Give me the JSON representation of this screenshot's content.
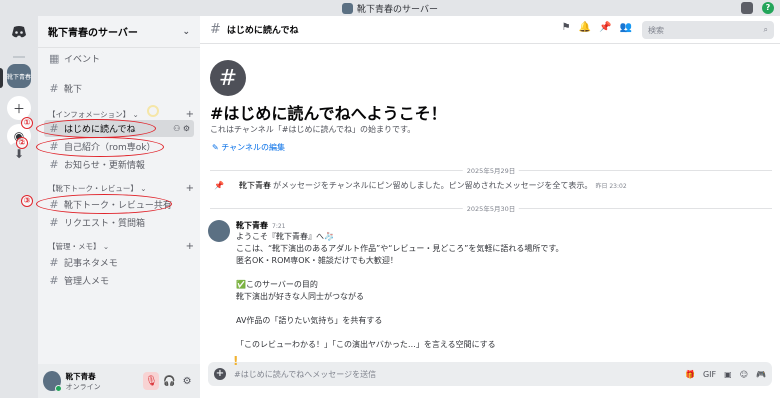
{
  "window": {
    "title": "靴下青春のサーバー"
  },
  "server": {
    "name": "靴下青春のサーバー",
    "icon_label": "靴下青春"
  },
  "sidebar": {
    "events_label": "イベント",
    "top_channel": "靴下",
    "categories": [
      {
        "label": "【インフォメーション】",
        "channels": [
          "はじめに読んでね",
          "自己紹介（rom専ok）",
          "お知らせ・更新情報"
        ]
      },
      {
        "label": "【靴下トーク・レビュー】",
        "channels": [
          "靴下トーク・レビュー共有",
          "リクエスト・質問箱"
        ]
      },
      {
        "label": "【管理・メモ】",
        "channels": [
          "記事ネタメモ",
          "管理人メモ"
        ]
      }
    ]
  },
  "user": {
    "name": "靴下青春",
    "status": "オンライン"
  },
  "header": {
    "channel": "はじめに読んでね",
    "search_placeholder": "検索"
  },
  "welcome": {
    "title": "#はじめに読んでねへようこそ！",
    "subtitle": "これはチャンネル「#はじめに読んでね」の始まりです。",
    "edit_label": "チャンネルの編集"
  },
  "dividers": [
    "2025年5月29日",
    "2025年5月30日"
  ],
  "system_message": {
    "author": "靴下青春",
    "text": "がメッセージをチャンネルにピン留めしました。ピン留めされたメッセージを全て表示。",
    "time": "昨日 23:02"
  },
  "message": {
    "author": "靴下青春",
    "time": "7:21",
    "lines": [
      "ようこそ『靴下青春』へ🧦",
      "ここは、“靴下演出のあるアダルト作品”や“レビュー・見どころ”を気軽に語れる場所です。",
      "匿名OK・ROM専OK・雑談だけでも大歓迎！",
      "",
      "✅このサーバーの目的",
      "靴下演出が好きな人同士がつながる",
      "",
      "AV作品の「語りたい気持ち」を共有する",
      "",
      "「このレビューわかる！」「この演出ヤバかった…」を言える空間にする"
    ]
  },
  "composer": {
    "placeholder": "#はじめに読んでねへメッセージを送信"
  },
  "annotations": [
    "①",
    "②",
    "③"
  ],
  "colors": {
    "annotation": "#e0242b",
    "link": "#006ce7",
    "online": "#23a55a"
  }
}
